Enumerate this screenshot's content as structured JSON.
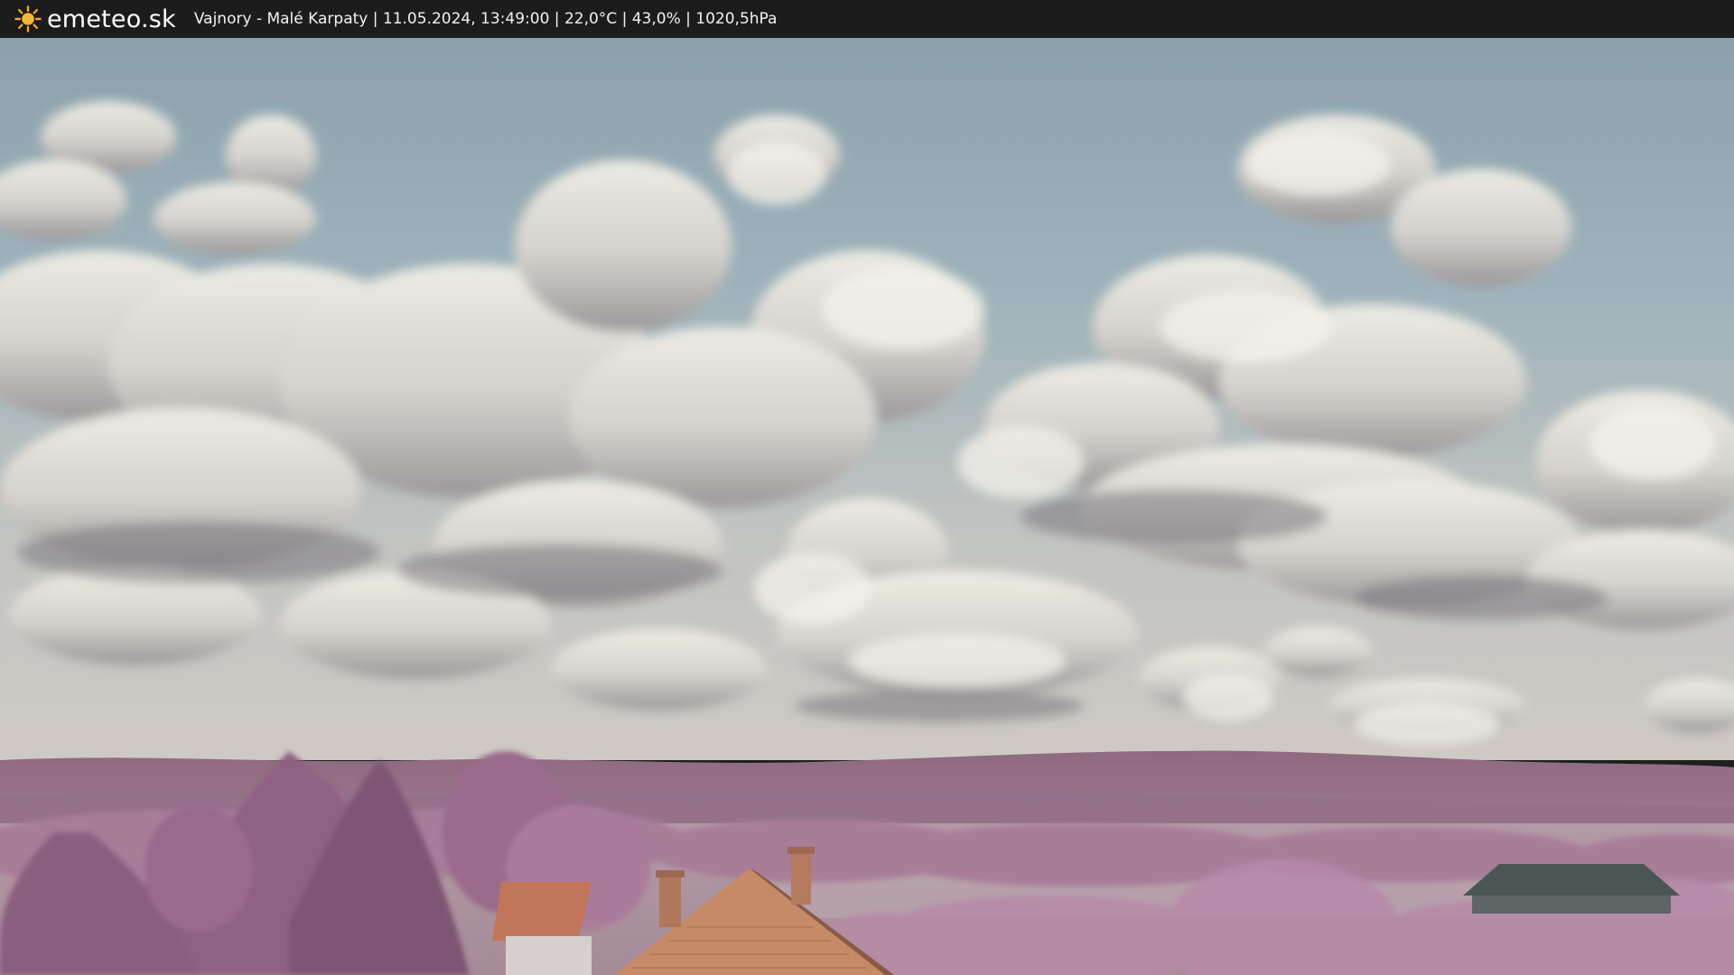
{
  "header": {
    "brand": "emeteo.sk",
    "brand_icon": "sun-icon",
    "location": "Vajnory - Malé Karpaty",
    "datetime": "11.05.2024, 13:49:00",
    "temperature": "22,0°C",
    "humidity": "43,0%",
    "pressure": "1020,5hPa"
  },
  "colors": {
    "bar_background": "#1c1c1c",
    "sun": "#f5a623",
    "sky_top": "#8aa3ad",
    "sky_bottom": "#c9c6c3",
    "foliage": "#9c6a8c",
    "roof": "#c98462"
  }
}
